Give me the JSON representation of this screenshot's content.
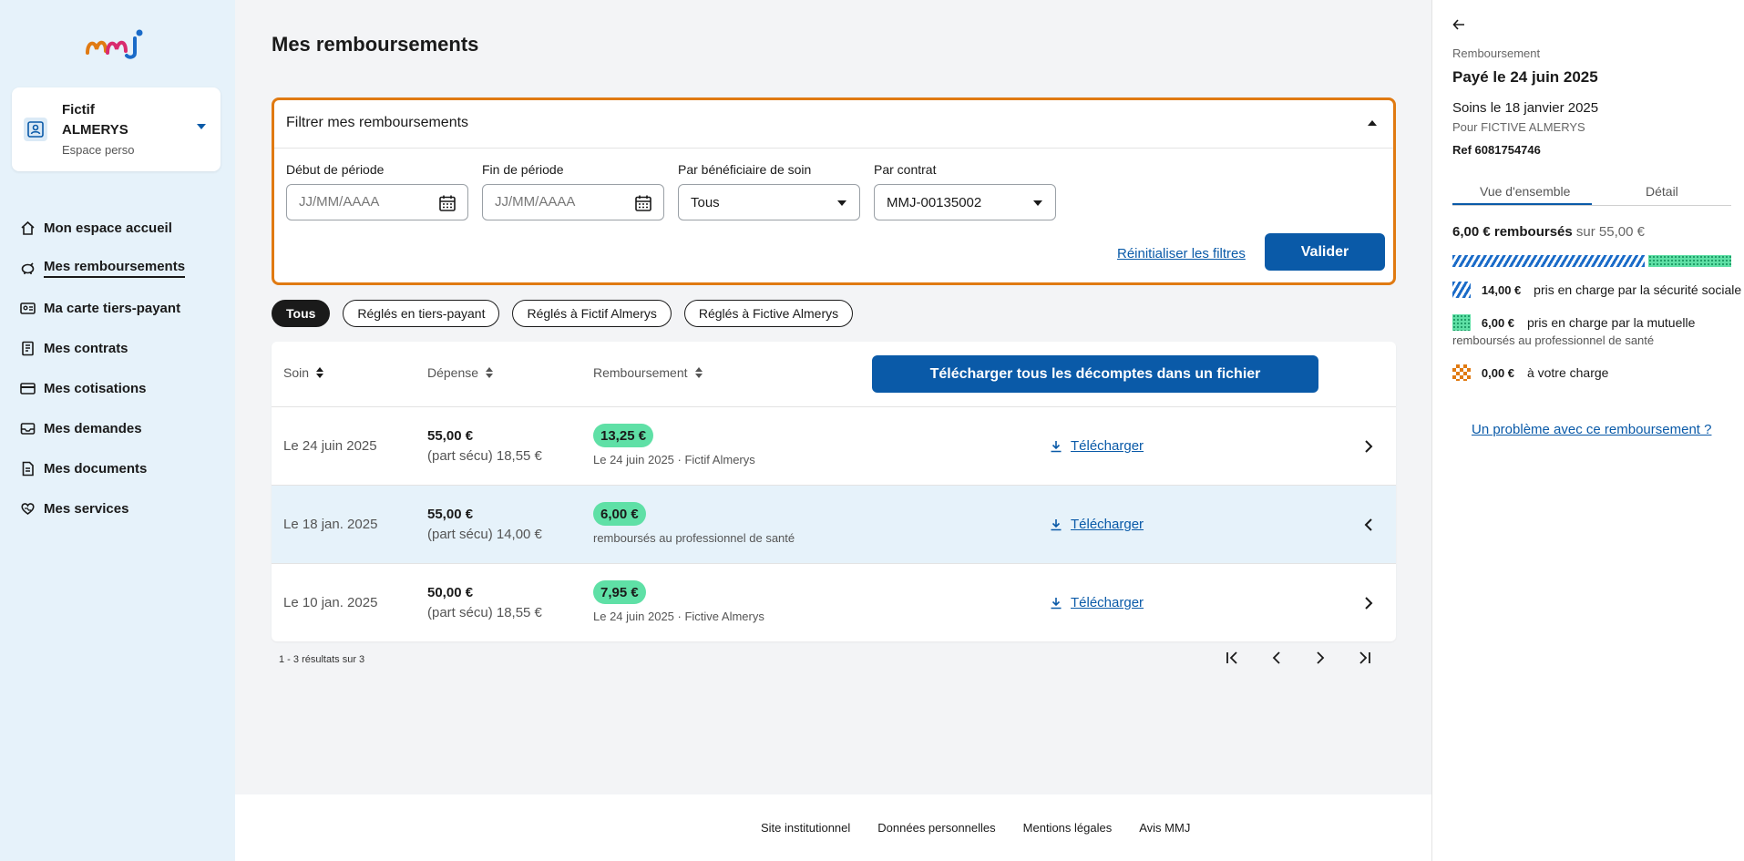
{
  "colors": {
    "brand_blue": "#0a5aa8",
    "filter_border": "#e07a12",
    "badge_green": "#5fe0a6",
    "sidebar_bg": "#e6f2fa"
  },
  "sidebar": {
    "logo_text": "mmj",
    "profile": {
      "first_name": "Fictif",
      "last_name": "ALMERYS",
      "subtitle": "Espace perso"
    },
    "items": [
      {
        "label": "Mon espace accueil",
        "icon": "home-icon",
        "active": false
      },
      {
        "label": "Mes remboursements",
        "icon": "piggy-bank-icon",
        "active": true
      },
      {
        "label": "Ma carte tiers-payant",
        "icon": "id-card-icon",
        "active": false
      },
      {
        "label": "Mes contrats",
        "icon": "contract-icon",
        "active": false
      },
      {
        "label": "Mes cotisations",
        "icon": "credit-card-icon",
        "active": false
      },
      {
        "label": "Mes demandes",
        "icon": "inbox-icon",
        "active": false
      },
      {
        "label": "Mes documents",
        "icon": "document-icon",
        "active": false
      },
      {
        "label": "Mes services",
        "icon": "heart-hand-icon",
        "active": false
      }
    ]
  },
  "main": {
    "title": "Mes remboursements",
    "filter": {
      "header": "Filtrer mes remboursements",
      "start": {
        "label": "Début de période",
        "placeholder": "JJ/MM/AAAA"
      },
      "end": {
        "label": "Fin de période",
        "placeholder": "JJ/MM/AAAA"
      },
      "beneficiary": {
        "label": "Par bénéficiaire de soin",
        "value": "Tous"
      },
      "contract": {
        "label": "Par contrat",
        "value": "MMJ-00135002"
      },
      "reset": "Réinitialiser les filtres",
      "submit": "Valider"
    },
    "chips": [
      {
        "label": "Tous",
        "active": true
      },
      {
        "label": "Réglés en tiers-payant",
        "active": false
      },
      {
        "label": "Réglés à Fictif Almerys",
        "active": false
      },
      {
        "label": "Réglés à Fictive Almerys",
        "active": false
      }
    ],
    "table": {
      "headers": {
        "soin": "Soin",
        "depense": "Dépense",
        "remboursement": "Remboursement"
      },
      "download_all": "Télécharger tous les décomptes dans un fichier",
      "download_label": "Télécharger",
      "rows": [
        {
          "date": "Le 24 juin 2025",
          "amount": "55,00 €",
          "secu": "(part sécu) 18,55 €",
          "refund": "13,25 €",
          "detail": "Le 24 juin 2025 · Fictif Almerys",
          "selected": false
        },
        {
          "date": "Le 18 jan. 2025",
          "amount": "55,00 €",
          "secu": "(part sécu) 14,00 €",
          "refund": "6,00 €",
          "detail": "remboursés au professionnel de santé",
          "selected": true
        },
        {
          "date": "Le 10 jan. 2025",
          "amount": "50,00 €",
          "secu": "(part sécu) 18,55 €",
          "refund": "7,95 €",
          "detail": "Le 24 juin 2025 · Fictive Almerys",
          "selected": false
        }
      ]
    },
    "results": "1 - 3 résultats sur 3"
  },
  "footer": {
    "links": [
      "Site institutionnel",
      "Données personnelles",
      "Mentions légales",
      "Avis MMJ"
    ]
  },
  "panel": {
    "eyebrow": "Remboursement",
    "title": "Payé le 24 juin 2025",
    "soins": "Soins le 18 janvier 2025",
    "pour": "Pour FICTIVE ALMERYS",
    "ref": "Ref 6081754746",
    "tabs": [
      "Vue d'ensemble",
      "Détail"
    ],
    "total_amount": "6,00 € remboursés",
    "total_sur": "sur 55,00 €",
    "bar": {
      "secu": 14.0,
      "mutuelle": 6.0
    },
    "legend": [
      {
        "amount": "14,00 €",
        "label": "pris en charge par la sécurité sociale"
      },
      {
        "amount": "6,00 €",
        "label": "pris en charge par la mutuelle"
      },
      {
        "amount": "0,00 €",
        "label": "à votre charge"
      }
    ],
    "legend_sub": "remboursés au professionnel de santé",
    "problem": "Un problème avec ce remboursement ?"
  }
}
